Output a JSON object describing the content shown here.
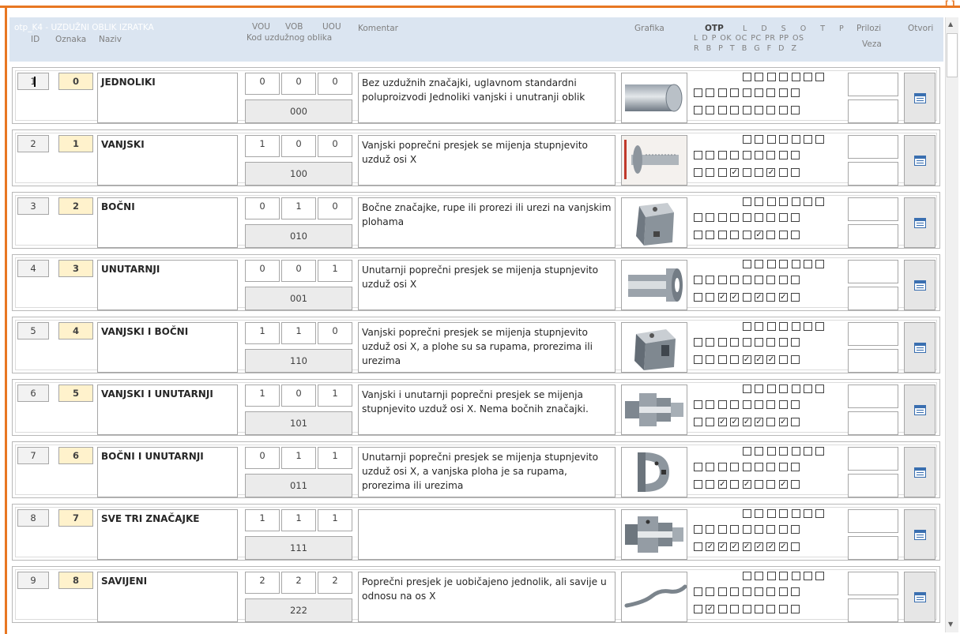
{
  "header": {
    "title": "otp_K4 - UZDUŽNI OBLIK IZRATKA",
    "col_id": "ID",
    "col_oznaka": "Oznaka",
    "col_naziv": "Naziv",
    "col_vou": "VOU",
    "col_vob": "VOB",
    "col_uou": "UOU",
    "col_kod": "Kod uzdužnog oblika",
    "col_komentar": "Komentar",
    "col_grafika": "Grafika",
    "col_otp": "OTP",
    "otp_line1": "L D S O T P",
    "otp_line2": "L D P OK OC PC PR PP OS",
    "otp_line3": "R B P T B G F D Z",
    "col_prilozi": "Prilozi",
    "col_veza": "Veza",
    "col_otvori": "Otvori"
  },
  "colors": {
    "accent": "#e87722",
    "header_bg": "#dbe5f1",
    "oznaka_bg": "#fff2cc"
  },
  "rows": [
    {
      "id": "1",
      "oznaka": "0",
      "naziv": "JEDNOLIKI",
      "vou": "0",
      "vob": "0",
      "uou": "0",
      "kod": "000",
      "komentar": "Bez uzdužnih značajki, uglavnom standardni poluproizvodi Jednoliki vanjski i unutranji oblik",
      "grafika": "cylinder",
      "cb_mid": [
        0,
        0,
        0,
        0,
        0,
        0,
        0,
        0,
        0,
        0,
        0,
        0,
        0,
        0
      ],
      "cb_bot": [
        0,
        0,
        0,
        0,
        0,
        0,
        0,
        0,
        0
      ]
    },
    {
      "id": "2",
      "oznaka": "1",
      "naziv": "VANJSKI",
      "vou": "1",
      "vob": "0",
      "uou": "0",
      "kod": "100",
      "komentar": "Vanjski poprečni presjek se mijenja stupnjevito uzduž osi X",
      "grafika": "bolt",
      "cb_mid": [
        0,
        0,
        0,
        0,
        0,
        0,
        0,
        0,
        0,
        0,
        0,
        0,
        0,
        0
      ],
      "cb_bot": [
        0,
        0,
        0,
        1,
        0,
        0,
        1,
        0,
        0
      ]
    },
    {
      "id": "3",
      "oznaka": "2",
      "naziv": "BOČNI",
      "vou": "0",
      "vob": "1",
      "uou": "0",
      "kod": "010",
      "komentar": "Bočne značajke, rupe ili prorezi ili urezi na vanjskim plohama",
      "grafika": "cube",
      "cb_mid": [
        0,
        0,
        0,
        0,
        0,
        0,
        0,
        0,
        0,
        0,
        0,
        0,
        0,
        0
      ],
      "cb_bot": [
        0,
        0,
        0,
        0,
        0,
        1,
        0,
        0,
        0
      ]
    },
    {
      "id": "4",
      "oznaka": "3",
      "naziv": "UNUTARNJI",
      "vou": "0",
      "vob": "0",
      "uou": "1",
      "kod": "001",
      "komentar": "Unutarnji poprečni  presjek se mijenja stupnjevito uzduž osi X",
      "grafika": "hollow",
      "cb_mid": [
        0,
        0,
        0,
        0,
        0,
        0,
        0,
        0,
        0,
        0,
        0,
        0,
        0,
        0
      ],
      "cb_bot": [
        0,
        0,
        1,
        1,
        0,
        1,
        0,
        1,
        0
      ]
    },
    {
      "id": "5",
      "oznaka": "4",
      "naziv": "VANJSKI I BOČNI",
      "vou": "1",
      "vob": "1",
      "uou": "0",
      "kod": "110",
      "komentar": "Vanjski poprečni presjek se mijenja stupnjevito uzduž osi X, a plohe su sa rupama, prorezima ili urezima",
      "grafika": "block",
      "cb_mid": [
        0,
        0,
        0,
        0,
        0,
        0,
        0,
        0,
        0,
        0,
        0,
        0,
        0,
        0
      ],
      "cb_bot": [
        0,
        0,
        0,
        0,
        1,
        1,
        1,
        0,
        0
      ]
    },
    {
      "id": "6",
      "oznaka": "5",
      "naziv": "VANJSKI I UNUTARNJI",
      "vou": "1",
      "vob": "0",
      "uou": "1",
      "kod": "101",
      "komentar": "Vanjski i unutarnji poprečni presjek se mijenja stupnjevito uzduž osi X. Nema bočnih značajki.",
      "grafika": "stepped",
      "cb_mid": [
        0,
        0,
        0,
        0,
        0,
        0,
        0,
        0,
        0,
        0,
        0,
        0,
        0,
        0
      ],
      "cb_bot": [
        0,
        0,
        1,
        1,
        1,
        1,
        0,
        1,
        0
      ]
    },
    {
      "id": "7",
      "oznaka": "6",
      "naziv": "BOČNI I UNUTARNJI",
      "vou": "0",
      "vob": "1",
      "uou": "1",
      "kod": "011",
      "komentar": "Unutarnji poprečni presjek se mijenja stupnjevito uzduž osi X, a vanjska ploha je sa rupama, prorezima ili urezima",
      "grafika": "ring",
      "cb_mid": [
        0,
        0,
        0,
        0,
        0,
        0,
        0,
        0,
        0,
        0,
        0,
        0,
        0,
        0
      ],
      "cb_bot": [
        0,
        0,
        1,
        0,
        1,
        0,
        0,
        1,
        0
      ]
    },
    {
      "id": "8",
      "oznaka": "7",
      "naziv": "SVE TRI ZNAČAJKE",
      "vou": "1",
      "vob": "1",
      "uou": "1",
      "kod": "111",
      "komentar": "",
      "grafika": "complex",
      "cb_mid": [
        0,
        0,
        0,
        0,
        0,
        0,
        0,
        0,
        0,
        0,
        0,
        0,
        0,
        0
      ],
      "cb_bot": [
        0,
        1,
        1,
        1,
        1,
        1,
        1,
        1,
        0
      ]
    },
    {
      "id": "9",
      "oznaka": "8",
      "naziv": "SAVIJENI",
      "vou": "2",
      "vob": "2",
      "uou": "2",
      "kod": "222",
      "komentar": "Poprečni presjek je uobičajeno jednolik, ali savije u odnosu na os X",
      "grafika": "bent",
      "cb_mid": [
        0,
        0,
        0,
        0,
        0,
        0,
        0,
        0,
        0,
        0,
        0,
        0,
        0,
        0
      ],
      "cb_bot": [
        0,
        1,
        0,
        0,
        0,
        0,
        0,
        0,
        0
      ]
    }
  ]
}
